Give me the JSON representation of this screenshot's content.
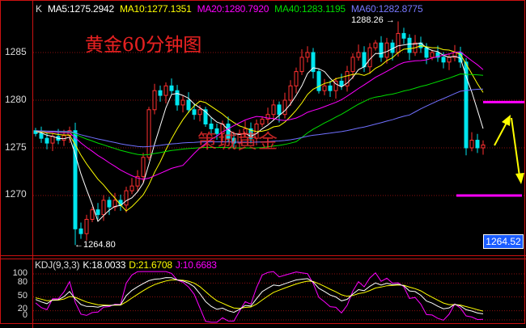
{
  "legend": {
    "k": "K",
    "ma5": "MA5:1275.2942",
    "ma10": "MA10:1277.1351",
    "ma20": "MA20:1280.7920",
    "ma40": "MA40:1283.1195",
    "ma60": "MA60:1282.8775"
  },
  "title": {
    "text": "黄金",
    "bold": "60",
    "suffix": "分钟图"
  },
  "watermark": "策城黄金",
  "annotations": {
    "high": "1288.26",
    "low": "1264.80",
    "current_price": "1264.52"
  },
  "kdj_legend": {
    "name": "KDJ(9,3,3)",
    "k": "K:18.0033",
    "d": "D:21.6708",
    "j": "J:10.6683"
  },
  "colors": {
    "up": "#ff3030",
    "down": "#00e5ee",
    "ma5": "#ffffff",
    "ma10": "#ffff00",
    "ma20": "#ff00ff",
    "ma40": "#00dd00",
    "ma60": "#7070ff",
    "frame": "#cc1111",
    "target_line": "#ff00ff",
    "arrow": "#ffff00",
    "price_box": "#1a5cff"
  },
  "chart_data": [
    {
      "type": "candlestick",
      "title": "黄金60分钟图",
      "y_ticks": [
        "1285",
        "1280",
        "1275",
        "1270"
      ],
      "ylim": [
        1263.7,
        1290.5
      ],
      "first_open": 1276.8,
      "wick_pad": 0.6,
      "close": [
        1276.5,
        1276,
        1275.5,
        1276.2,
        1275.8,
        1276.3,
        1276.8,
        1266.5,
        1266,
        1267.5,
        1268.5,
        1268,
        1269.5,
        1268.8,
        1269.5,
        1269,
        1270.5,
        1271,
        1272,
        1274,
        1279,
        1281,
        1280.5,
        1281.5,
        1281,
        1279.5,
        1280,
        1279,
        1278.5,
        1279,
        1277.5,
        1277,
        1276.5,
        1277.5,
        1276,
        1275.5,
        1276.5,
        1277,
        1276,
        1277.5,
        1278,
        1278.5,
        1279.5,
        1278.5,
        1280,
        1281.5,
        1283,
        1284.5,
        1285,
        1283,
        1281,
        1281.5,
        1281,
        1282,
        1281.5,
        1283,
        1284.5,
        1285,
        1283.5,
        1285.5,
        1286,
        1284.5,
        1286,
        1285,
        1287,
        1286.5,
        1285,
        1286,
        1285.5,
        1284.5,
        1285,
        1284.5,
        1284,
        1284.5,
        1285,
        1284,
        1275,
        1275.8,
        1275,
        1275.3
      ],
      "extreme_high": {
        "index": 64,
        "value": 1288.26
      },
      "extreme_low": {
        "index": 7,
        "value": 1264.8
      },
      "moving_averages": [
        5,
        10,
        20,
        40,
        60
      ],
      "target_levels": [
        1279.8,
        1270.0
      ]
    },
    {
      "type": "line",
      "title": "KDJ(9,3,3)",
      "y_ticks": [
        "100",
        "80",
        "50",
        "20",
        "0"
      ],
      "ylim": [
        0,
        100
      ]
    }
  ]
}
